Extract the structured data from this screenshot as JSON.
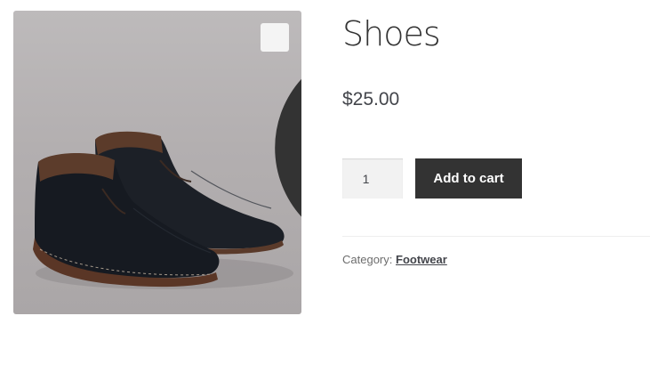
{
  "product": {
    "title": "Shoes",
    "price": "$25.00",
    "image_alt": "Pair of dark leather chukka boots",
    "zoom_icon": "zoom-in-icon"
  },
  "cart_form": {
    "quantity_value": "1",
    "add_to_cart_label": "Add to cart"
  },
  "meta": {
    "category_label": "Category:",
    "category_link": "Footwear"
  },
  "colors": {
    "button_bg": "#333333",
    "button_text": "#ffffff",
    "image_bg": "#b3afb0"
  }
}
